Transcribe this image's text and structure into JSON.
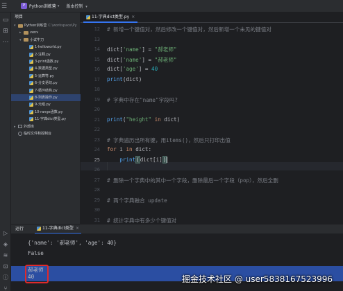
{
  "titlebar": {
    "project_badge": "P",
    "project_name": "Python训练营",
    "branch": "版本控制"
  },
  "project_panel": {
    "title": "项目",
    "tree": [
      {
        "label": "Python训练营",
        "hint": "C:\\workspace\\Py",
        "kind": "folder",
        "expanded": true
      },
      {
        "label": "venv",
        "kind": "folder",
        "expanded": false
      },
      {
        "label": "小试牛刀",
        "kind": "folder",
        "expanded": true
      },
      {
        "label": "1-helloworld.py",
        "kind": "py"
      },
      {
        "label": "2-注释.py",
        "kind": "py"
      },
      {
        "label": "3-print函数.py",
        "kind": "py"
      },
      {
        "label": "4-数据类型.py",
        "kind": "py"
      },
      {
        "label": "5-运算符.py",
        "kind": "py"
      },
      {
        "label": "6-分支语句.py",
        "kind": "py"
      },
      {
        "label": "7-循环结构.py",
        "kind": "py"
      },
      {
        "label": "8-列表操作.py",
        "kind": "py",
        "selected": true
      },
      {
        "label": "9-元组.py",
        "kind": "py"
      },
      {
        "label": "10-range函数.py",
        "kind": "py"
      },
      {
        "label": "11-字典dict类型.py",
        "kind": "py"
      },
      {
        "label": "外部库",
        "kind": "lib",
        "expanded": false
      },
      {
        "label": "临时文件和控制台",
        "kind": "scratch"
      }
    ]
  },
  "editor": {
    "tab_label": "11-字典dict类型.py",
    "lines": [
      {
        "n": "12",
        "t": "# 新增一个键值对，然后修改一个键值对，然后新增一个未见的键值对"
      },
      {
        "n": "13",
        "t": ""
      },
      {
        "n": "14",
        "t": "dict['name'] = \"郝老师\""
      },
      {
        "n": "15",
        "t": "dict['name'] = \"郝老师\""
      },
      {
        "n": "16",
        "t": "dict['age'] = 40"
      },
      {
        "n": "17",
        "t": "print(dict)"
      },
      {
        "n": "18",
        "t": ""
      },
      {
        "n": "19",
        "t": "# 字典中存在\"name\"字段吗?"
      },
      {
        "n": "20",
        "t": ""
      },
      {
        "n": "21",
        "t": "print(\"height\" in dict)"
      },
      {
        "n": "22",
        "t": ""
      },
      {
        "n": "23",
        "t": "# 字典遍历出所有键，用items()，然后只打印出值"
      },
      {
        "n": "24",
        "t": "for i in dict:"
      },
      {
        "n": "25",
        "t": "    print(dict[i])"
      },
      {
        "n": "26",
        "t": ""
      },
      {
        "n": "27",
        "t": "# 删除一个字典中的其中一个字段，删除最后一个字段（pop），然后全删"
      },
      {
        "n": "28",
        "t": ""
      },
      {
        "n": "29",
        "t": "# 两个字典融合 update"
      },
      {
        "n": "30",
        "t": ""
      },
      {
        "n": "31",
        "t": "# 统计字典中有多少个键值对"
      }
    ]
  },
  "run_panel": {
    "label": "运行",
    "tab_label": "11-字典dict类型",
    "output": [
      "{'name': '郝老师', 'age': 40}",
      "False",
      "郝老师",
      "40"
    ]
  },
  "watermark": "掘金技术社区 @ user5838167523996"
}
